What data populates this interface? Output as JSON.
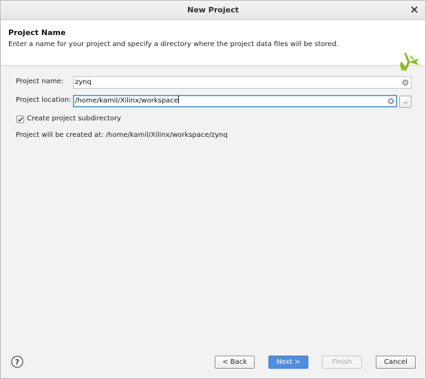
{
  "window": {
    "title": "New Project"
  },
  "header": {
    "title": "Project Name",
    "description": "Enter a name for your project and specify a directory where the project data files will be stored.",
    "logo_icon": "xilinx-logo-icon"
  },
  "form": {
    "project_name_label": "Project name:",
    "project_name_value": "zynq",
    "project_location_label": "Project location:",
    "project_location_value": "/home/kamil/Xilinx/workspace",
    "browse_label": "...",
    "create_subdirectory_label": "Create project subdirectory",
    "create_subdirectory_checked": true,
    "result_text": "Project will be created at: /home/kamil/Xilinx/workspace/zynq"
  },
  "footer": {
    "help_icon": "help-icon",
    "back_label": "< Back",
    "next_label": "Next >",
    "finish_label": "Finish",
    "cancel_label": "Cancel"
  },
  "colors": {
    "accent": "#4f8ede",
    "logo_green": "#8dbb2a",
    "focus_border": "#4a90d9"
  }
}
